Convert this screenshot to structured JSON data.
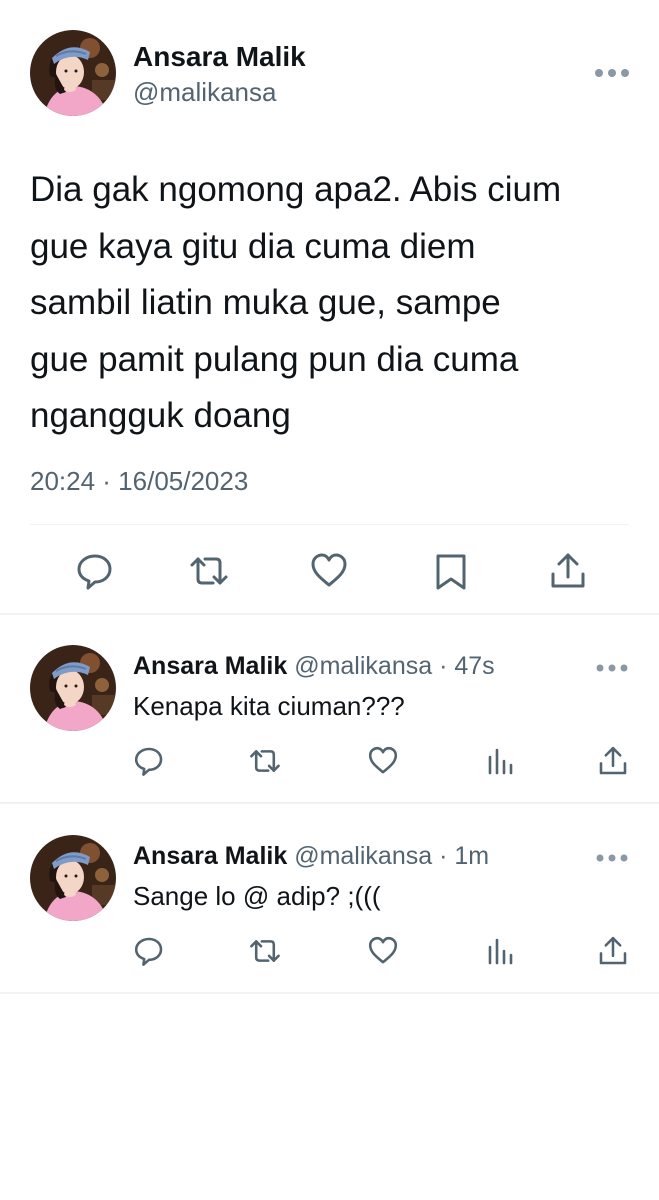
{
  "main_tweet": {
    "display_name": "Ansara Malik",
    "handle": "@malikansa",
    "text": "Dia gak ngomong apa2. Abis cium\ngue kaya gitu dia cuma diem\nsambil liatin muka gue, sampe\ngue pamit pulang pun dia cuma\nngangguk doang",
    "timestamp": "20:24 · 16/05/2023",
    "actions": [
      "reply-icon",
      "retweet-icon",
      "like-icon",
      "bookmark-icon",
      "share-icon"
    ]
  },
  "replies": [
    {
      "display_name": "Ansara Malik",
      "meta": "@malikansa · 47s",
      "text": "Kenapa kita ciuman???",
      "actions": [
        "reply-icon",
        "retweet-icon",
        "like-icon",
        "views-icon",
        "share-icon"
      ]
    },
    {
      "display_name": "Ansara Malik",
      "meta": "@malikansa · 1m",
      "text": "Sange lo @ adip? ;(((",
      "actions": [
        "reply-icon",
        "retweet-icon",
        "like-icon",
        "views-icon",
        "share-icon"
      ]
    }
  ],
  "colors": {
    "text_primary": "#0f1419",
    "text_secondary": "#536471",
    "divider": "#eff3f4"
  }
}
